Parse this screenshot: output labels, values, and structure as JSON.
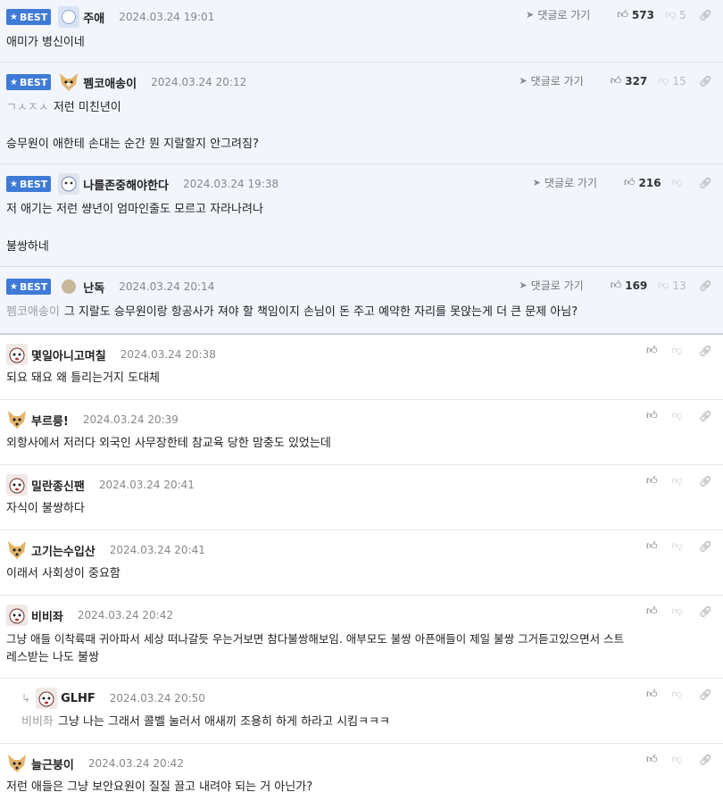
{
  "best_label": "BEST",
  "goto_label": "댓글로 가기",
  "comments": [
    {
      "nick": "주애",
      "date": "2024.03.24 19:01",
      "text": "애미가 병신이네",
      "up": "573",
      "down": "5"
    },
    {
      "nick": "펨코애송이",
      "date": "2024.03.24 20:12",
      "mention": "ㄱㅅㅈㅅ",
      "text1": "저런 미친년이",
      "text2": "승무원이 애한테 손대는 순간 뭔 지랄할지 안그려짐?",
      "up": "327",
      "down": "15"
    },
    {
      "nick": "나를존중해야한다",
      "date": "2024.03.24 19:38",
      "text1": "저 애기는 저런 썅년이 엄마인줄도 모르고 자라나려나",
      "text2": "불쌍하네",
      "up": "216",
      "down": ""
    },
    {
      "nick": "난독",
      "date": "2024.03.24 20:14",
      "mention": "펨코애송이",
      "text": "그 지랄도 승무원이랑 항공사가 져야 할 책임이지 손님이 돈 주고 예약한 자리를 못앉는게 더 큰 문제 아님?",
      "up": "169",
      "down": "13"
    },
    {
      "nick": "몇일아니고며칠",
      "date": "2024.03.24 20:38",
      "text": "되요 돼요 왜 틀리는거지 도대체"
    },
    {
      "nick": "부르릉!",
      "date": "2024.03.24 20:39",
      "text": "외항사에서 저러다 외국인 사무장한테 참교육 당한 맘충도 있었는데"
    },
    {
      "nick": "밀란종신팬",
      "date": "2024.03.24 20:41",
      "text": "자식이 불쌍하다"
    },
    {
      "nick": "고기는수입산",
      "date": "2024.03.24 20:41",
      "text": "이래서 사회성이 중요함"
    },
    {
      "nick": "비비좌",
      "date": "2024.03.24 20:42",
      "text1": "그냥 애들 이착륙때 귀아파서 세상 떠나갈듯 우는거보면 참다불쌍해보임. 애부모도 불쌍 아픈애들이 제일 불쌍 그거듣고있으면서 스트",
      "text2": "레스받는 나도 불쌍"
    },
    {
      "nick": "GLHF",
      "date": "2024.03.24 20:50",
      "mention": "비비좌",
      "text": "그냥 나는 그래서 콜벨 눌러서 애새끼 조용히 하게 하라고 시킴ㅋㅋㅋ"
    },
    {
      "nick": "늘근붕이",
      "date": "2024.03.24 20:42",
      "text": "저런 애들은 그냥 보안요원이 질질 끌고 내려야 되는 거 아닌가?"
    }
  ]
}
